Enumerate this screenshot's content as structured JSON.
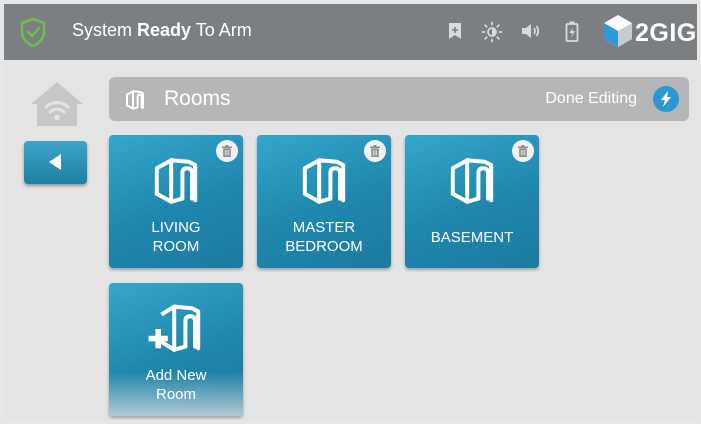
{
  "topbar": {
    "status_prefix": "System ",
    "status_bold": "Ready",
    "status_suffix": " To Arm",
    "brand": "2GIG",
    "icons": [
      "bookmark-icon",
      "brightness-icon",
      "volume-icon",
      "battery-icon"
    ]
  },
  "header": {
    "title": "Rooms",
    "done_label": "Done Editing"
  },
  "rooms": [
    {
      "line1": "LIVING",
      "line2": "ROOM"
    },
    {
      "line1": "MASTER",
      "line2": "BEDROOM"
    },
    {
      "line1": "BASEMENT",
      "line2": ""
    }
  ],
  "add_room": {
    "line1": "Add New",
    "line2": "Room"
  },
  "colors": {
    "topbar": "#7b7f82",
    "accent": "#1f86ad",
    "shield": "#6cc04a",
    "done_icon": "#2c97d3"
  }
}
